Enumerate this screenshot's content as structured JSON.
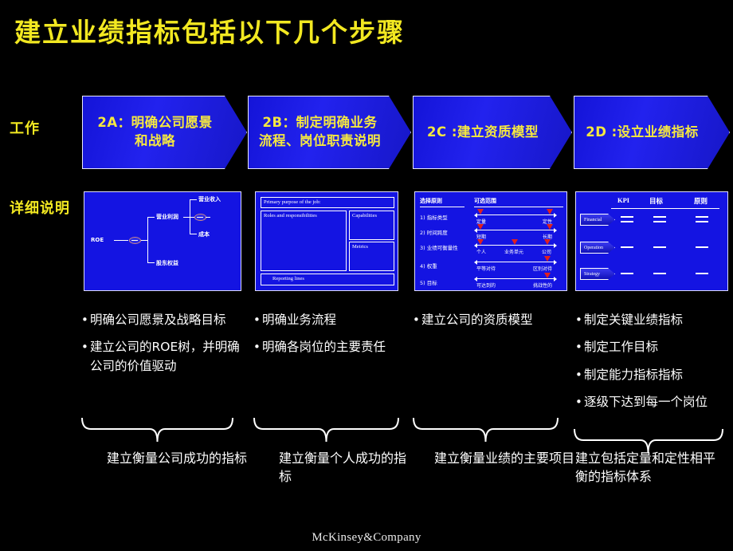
{
  "slide": {
    "title": "建立业绩指标包括以下几个步骤",
    "footer": "McKinsey&Company",
    "accent_yellow": "#f2e821",
    "panel_blue": "#1414e2",
    "background": "#000000"
  },
  "row_labels": {
    "work": "工作",
    "detail": "详细说明"
  },
  "steps": [
    {
      "id": "2A",
      "banner": "2A：明确公司愿景和战略",
      "bullets": [
        "明确公司愿景及战略目标",
        "建立公司的ROE树，并明确公司的价值驱动"
      ],
      "summary": "建立衡量公司成功的指标"
    },
    {
      "id": "2B",
      "banner": "2B：制定明确业务流程、岗位职责说明",
      "bullets": [
        "明确业务流程",
        "明确各岗位的主要责任"
      ],
      "summary": "建立衡量个人成功的指标"
    },
    {
      "id": "2C",
      "banner": "2C :建立资质模型",
      "bullets": [
        "建立公司的资质模型"
      ],
      "summary": "建立衡量业绩的主要项目"
    },
    {
      "id": "2D",
      "banner": "2D :设立业绩指标",
      "bullets": [
        "制定关键业绩指标",
        "制定工作目标",
        "制定能力指标指标",
        "逐级下达到每一个岗位"
      ],
      "summary": "建立包括定量和定性相平衡的指标体系"
    }
  ],
  "panels": {
    "roe_tree": {
      "root": "ROE",
      "level1": [
        "营业利润",
        "股东权益"
      ],
      "level2": [
        "营业收入",
        "成本"
      ],
      "operators": [
        "divide",
        "minus"
      ]
    },
    "job_description": {
      "header": "Primary purpose of the job:",
      "left_box": "Roles and responsibilities",
      "right_boxes": [
        "Capabilities",
        "Metrics"
      ],
      "footer_box": "Reporting lines"
    },
    "criteria_scales": {
      "col_headers": [
        "选择原则",
        "可选范围"
      ],
      "rows": [
        {
          "label": "1) 指标类型",
          "left": "定量",
          "right": "定性",
          "markers": [
            0,
            100
          ]
        },
        {
          "label": "2) 时间跨度",
          "left": "短期",
          "right": "长期",
          "markers": [
            0,
            100
          ]
        },
        {
          "label": "3) 业绩可衡量性",
          "left": "个人",
          "mid": "业务单元",
          "right": "公司",
          "markers": [
            0,
            50,
            100
          ]
        },
        {
          "label": "4) 权重",
          "left": "平等对待",
          "right": "区别对待",
          "markers": [
            100
          ]
        },
        {
          "label": "5) 目标",
          "left": "可达到的",
          "right": "挑战性的",
          "markers": [
            100
          ]
        }
      ]
    },
    "kpi_table": {
      "columns": [
        "KPI",
        "目标",
        "原则"
      ],
      "rows": [
        "Financial",
        "Operation",
        "Strategy"
      ]
    }
  }
}
